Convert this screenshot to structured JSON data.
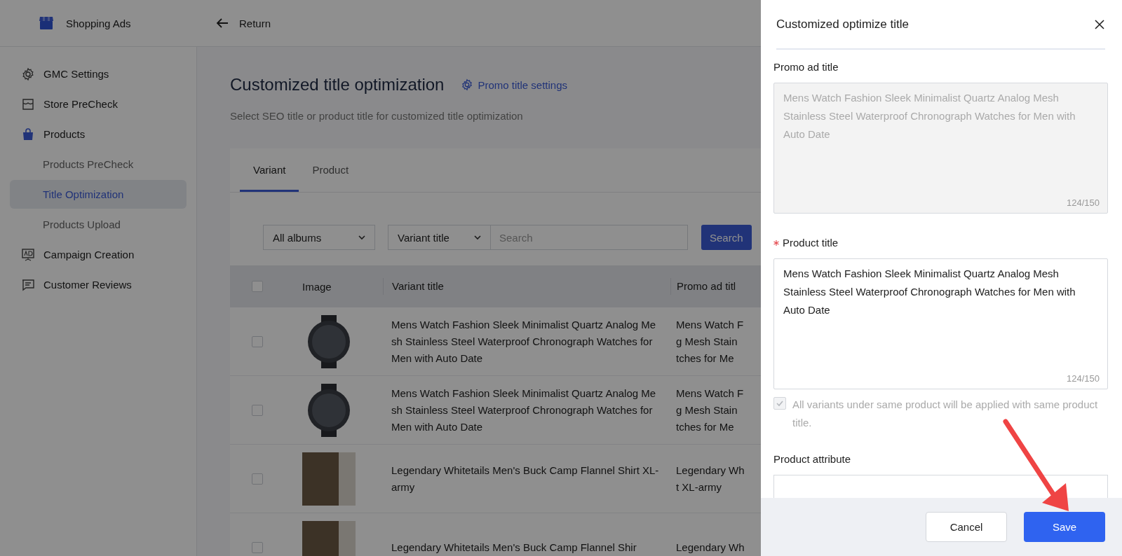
{
  "app": {
    "name": "Shopping Ads"
  },
  "header": {
    "back_label": "Return"
  },
  "sidebar": {
    "items": [
      {
        "label": "GMC Settings",
        "selected": false
      },
      {
        "label": "Store PreCheck",
        "selected": false
      },
      {
        "label": "Products",
        "selected": false,
        "expanded": true,
        "children": [
          {
            "label": "Products PreCheck",
            "selected": false
          },
          {
            "label": "Title Optimization",
            "selected": true
          },
          {
            "label": "Products Upload",
            "selected": false
          }
        ]
      },
      {
        "label": "Campaign Creation",
        "selected": false
      },
      {
        "label": "Customer Reviews",
        "selected": false
      }
    ]
  },
  "main": {
    "title": "Customized title optimization",
    "settings_link": "Promo title settings",
    "subtitle": "Select SEO title or product title for customized title optimization",
    "tabs": [
      {
        "label": "Variant",
        "selected": true
      },
      {
        "label": "Product",
        "selected": false
      }
    ],
    "filters": {
      "album": "All albums",
      "field": "Variant title",
      "search_placeholder": "Search",
      "search_button": "Search"
    },
    "table": {
      "columns": [
        "Image",
        "Variant title",
        "Promo ad titl"
      ],
      "select_all_checked": false,
      "rows": [
        {
          "checked": false,
          "kind": "watch",
          "variant_title": "Mens Watch Fashion Sleek Minimalist Quartz Analog Mesh Stainless Steel Waterproof Chronograph Watches for Men with Auto Date",
          "promo_lines": [
            "Mens Watch F",
            "g Mesh Stain",
            "tches for Me"
          ]
        },
        {
          "checked": false,
          "kind": "watch",
          "variant_title": "Mens Watch Fashion Sleek Minimalist Quartz Analog Mesh Stainless Steel Waterproof Chronograph Watches for Men with Auto Date",
          "promo_lines": [
            "Mens Watch F",
            "g Mesh Stain",
            "tches for Me"
          ]
        },
        {
          "checked": false,
          "kind": "shirt",
          "variant_title": "Legendary Whitetails Men's Buck Camp Flannel Shirt XL-army",
          "promo_lines": [
            "Legendary Wh",
            "t XL-army"
          ]
        },
        {
          "checked": false,
          "kind": "shirt",
          "variant_title": "Legendary Whitetails Men's Buck Camp Flannel Shir",
          "promo_lines": [
            "Legendary Wh"
          ]
        }
      ]
    }
  },
  "drawer": {
    "title": "Customized optimize title",
    "fields": [
      {
        "kind": "textarea",
        "label": "Promo ad title",
        "required": false,
        "disabled": true,
        "value": "Mens Watch Fashion Sleek Minimalist Quartz Analog Mesh Stainless Steel Waterproof Chronograph Watches for Men with Auto Date",
        "count": "124/150"
      },
      {
        "kind": "textarea",
        "label": "Product title",
        "required": true,
        "disabled": false,
        "value": "Mens Watch Fashion Sleek Minimalist Quartz Analog Mesh Stainless Steel Waterproof Chronograph Watches for Men with Auto Date",
        "count": "124/150"
      },
      {
        "kind": "checkbox",
        "label": "All variants under same product will be applied with same product title.",
        "checked": true,
        "disabled": true
      },
      {
        "kind": "input",
        "label": "Product attribute",
        "required": false
      }
    ],
    "buttons": [
      {
        "label": "Cancel",
        "kind": "secondary"
      },
      {
        "label": "Save",
        "kind": "primary"
      }
    ]
  }
}
